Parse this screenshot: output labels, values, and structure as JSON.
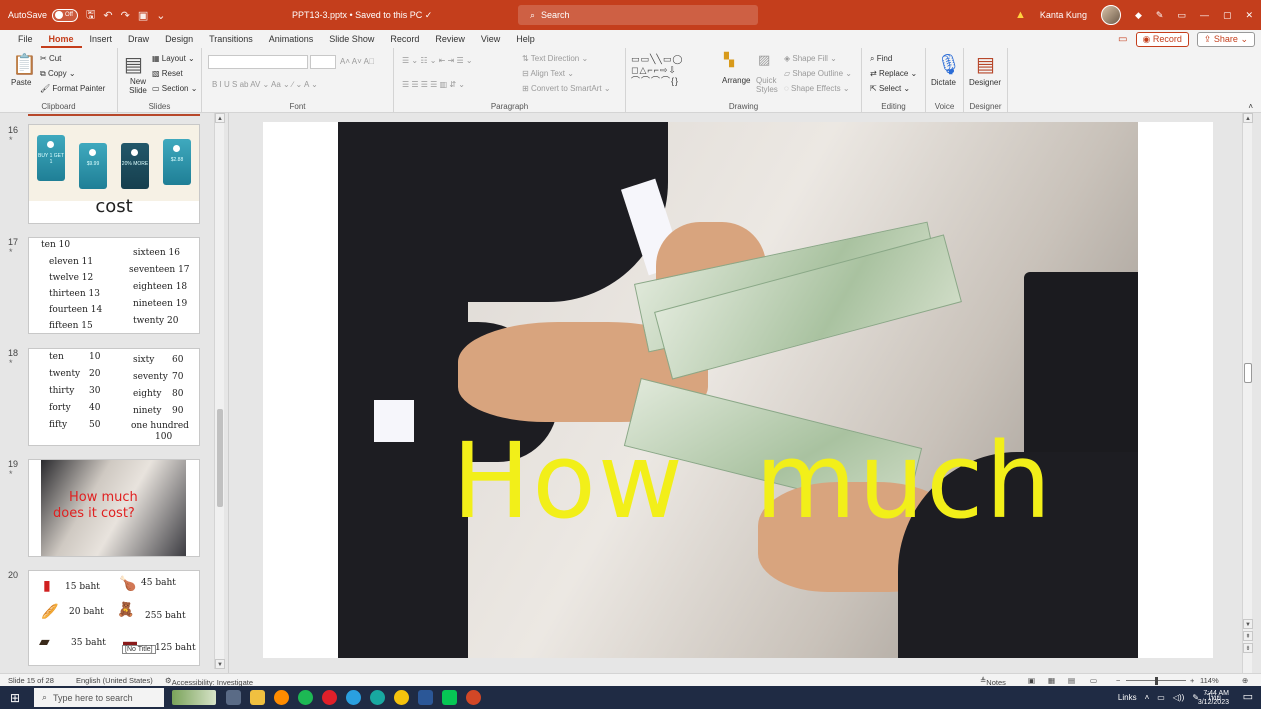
{
  "titlebar": {
    "autosave_label": "AutoSave",
    "autosave_state": "Off",
    "doc_title": "PPT13-3.pptx • Saved to this PC ✓",
    "search_placeholder": "Search",
    "user_name": "Kanta Kung"
  },
  "tabs": [
    "File",
    "Home",
    "Insert",
    "Draw",
    "Design",
    "Transitions",
    "Animations",
    "Slide Show",
    "Record",
    "Review",
    "View",
    "Help"
  ],
  "active_tab": "Home",
  "tabs_right": {
    "record": "Record",
    "share": "Share"
  },
  "ribbon": {
    "clipboard": {
      "label": "Clipboard",
      "paste": "Paste",
      "cut": "Cut",
      "copy": "Copy",
      "format_painter": "Format Painter"
    },
    "slides": {
      "label": "Slides",
      "new_slide": "New Slide",
      "layout": "Layout",
      "reset": "Reset",
      "section": "Section"
    },
    "font": {
      "label": "Font"
    },
    "paragraph": {
      "label": "Paragraph",
      "text_direction": "Text Direction",
      "align_text": "Align Text",
      "convert_smartart": "Convert to SmartArt"
    },
    "drawing": {
      "label": "Drawing",
      "arrange": "Arrange",
      "quick_styles": "Quick Styles",
      "shape_fill": "Shape Fill",
      "shape_outline": "Shape Outline",
      "shape_effects": "Shape Effects"
    },
    "editing": {
      "label": "Editing",
      "find": "Find",
      "replace": "Replace",
      "select": "Select"
    },
    "voice": {
      "label": "Voice",
      "dictate": "Dictate"
    },
    "designer": {
      "label": "Designer",
      "designer": "Designer"
    }
  },
  "thumbnails": {
    "s16": {
      "num": "16",
      "tags": [
        "BUY 1 GET 1",
        "$9.99",
        "20% MORE",
        "$2.88"
      ],
      "word": "cost"
    },
    "s17": {
      "num": "17",
      "left": [
        "ten  10",
        "eleven  11",
        "twelve  12",
        "thirteen 13",
        "fourteen 14",
        "fifteen  15"
      ],
      "right": [
        "sixteen 16",
        "seventeen 17",
        "eighteen 18",
        "nineteen 19",
        "twenty  20"
      ]
    },
    "s18": {
      "num": "18",
      "left_words": [
        "ten",
        "twenty",
        "thirty",
        "forty",
        "fifty"
      ],
      "left_nums": [
        "10",
        "20",
        "30",
        "40",
        "50"
      ],
      "right_words": [
        "sixty",
        "seventy",
        "eighty",
        "ninety",
        "one hundred"
      ],
      "right_nums": [
        "60",
        "70",
        "80",
        "90",
        "100"
      ]
    },
    "s19": {
      "num": "19",
      "text1": "How much",
      "text2": "does it cost?"
    },
    "s20": {
      "num": "20",
      "items": [
        "15 baht",
        "45 baht",
        "20 baht",
        "255 baht",
        "35 baht",
        "125 baht"
      ],
      "tooltip": "[No Title]"
    }
  },
  "slide": {
    "main_text": "How  much"
  },
  "statusbar": {
    "slide_count": "Slide 15 of 28",
    "language": "English (United States)",
    "accessibility": "Accessibility: Investigate",
    "notes": "Notes",
    "zoom": "114%"
  },
  "taskbar": {
    "search_placeholder": "Type here to search",
    "links": "Links",
    "lang": "ไทย",
    "time": "7:44 AM",
    "date": "3/12/2023"
  }
}
